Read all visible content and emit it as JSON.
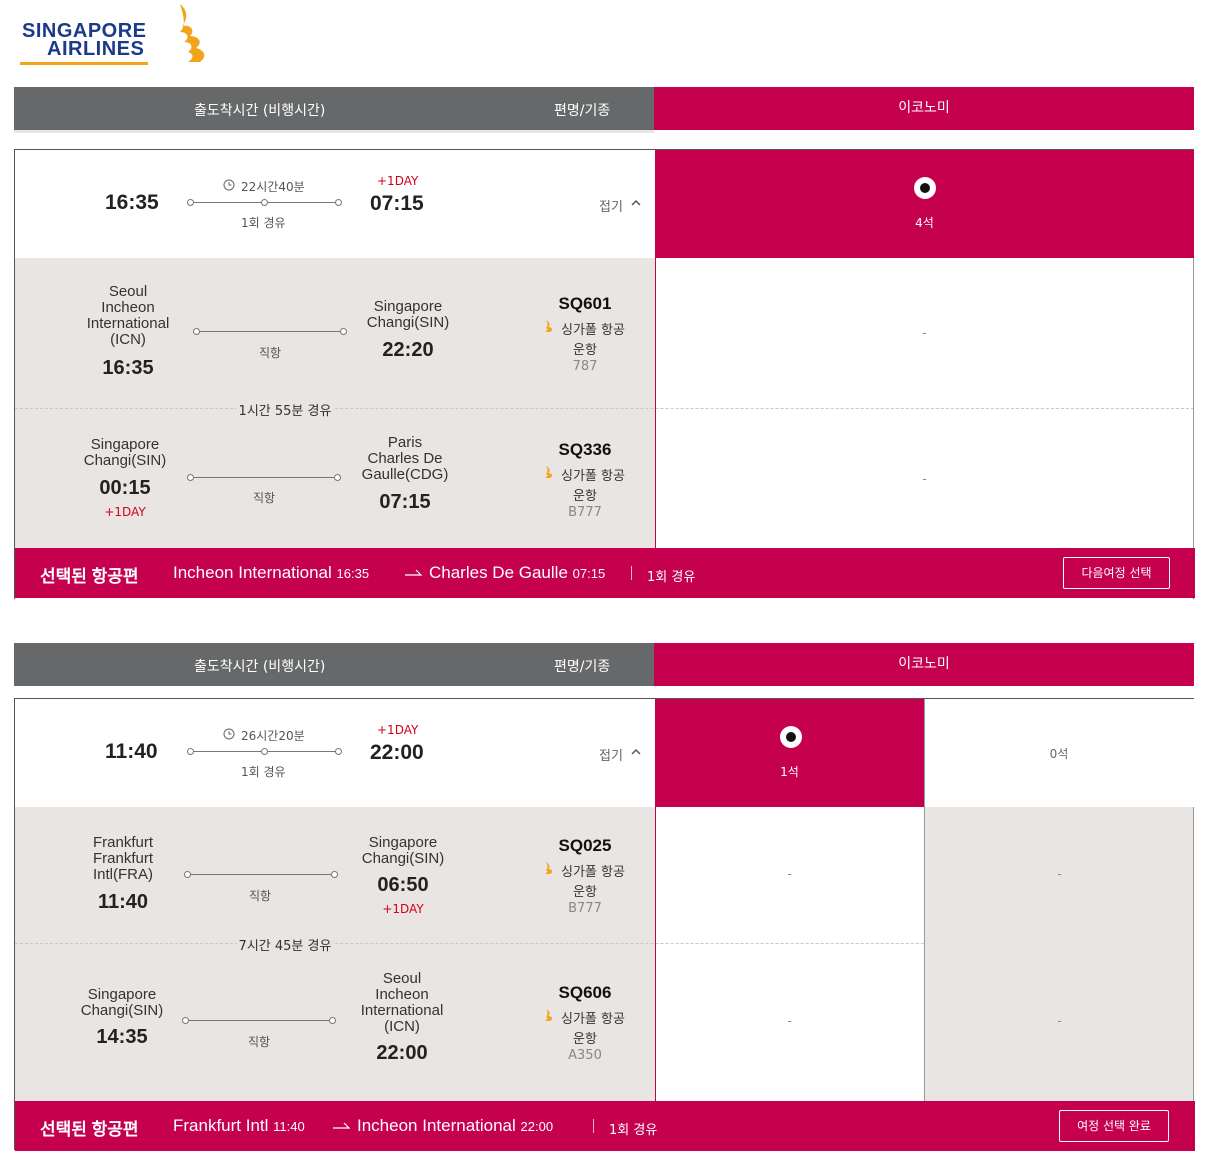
{
  "brand": {
    "line1": "SINGAPORE",
    "line2": "AIRLINES",
    "colors": {
      "navy": "#1b3a8a",
      "gold": "#f2a51b"
    }
  },
  "colors": {
    "accent": "#c4004f",
    "header_gray": "#676869",
    "segment_bg": "#e8e5e2",
    "red": "#d0021b"
  },
  "header": {
    "col_time": "출도착시간 (비행시간)",
    "col_flight": "편명/기종",
    "col_cabin": "이코노미"
  },
  "outbound": {
    "summary": {
      "dep": "16:35",
      "arr": "07:15",
      "duration": "22시간40분",
      "plus_day": "+1DAY",
      "stops": "1회 경유",
      "fold": "접기",
      "seats": "4석"
    },
    "segments": [
      {
        "from_city": [
          "Seoul",
          "Incheon",
          "International",
          "(ICN)"
        ],
        "dep": "16:35",
        "to_city": [
          "Singapore",
          "Changi(SIN)"
        ],
        "arr": "22:20",
        "type": "직항",
        "flight": "SQ601",
        "airline": "싱가폴 항공",
        "op": "운항",
        "aircraft": "787",
        "eco": "-"
      },
      {
        "from_city": [
          "Singapore",
          "Changi(SIN)"
        ],
        "dep": "00:15",
        "dep_plus": "+1DAY",
        "to_city": [
          "Paris",
          "Charles De",
          "Gaulle(CDG)"
        ],
        "arr": "07:15",
        "type": "직항",
        "flight": "SQ336",
        "airline": "싱가폴 항공",
        "op": "운항",
        "aircraft": "B777",
        "eco": "-"
      }
    ],
    "layover": "1시간 55분 경유",
    "selected": {
      "label": "선택된 항공편",
      "from": "Incheon International",
      "dep": "16:35",
      "to": "Charles De Gaulle",
      "arr": "07:15",
      "stops": "1회 경유",
      "button": "다음여정 선택"
    }
  },
  "inbound": {
    "summary": {
      "dep": "11:40",
      "arr": "22:00",
      "duration": "26시간20분",
      "plus_day": "+1DAY",
      "stops": "1회 경유",
      "fold": "접기",
      "seats": "1석",
      "seats2": "0석"
    },
    "segments": [
      {
        "from_city": [
          "Frankfurt",
          "Frankfurt",
          "Intl(FRA)"
        ],
        "dep": "11:40",
        "to_city": [
          "Singapore",
          "Changi(SIN)"
        ],
        "arr": "06:50",
        "arr_plus": "+1DAY",
        "type": "직항",
        "flight": "SQ025",
        "airline": "싱가폴 항공",
        "op": "운항",
        "aircraft": "B777",
        "eco": "-",
        "eco2": "-"
      },
      {
        "from_city": [
          "Singapore",
          "Changi(SIN)"
        ],
        "dep": "14:35",
        "to_city": [
          "Seoul",
          "Incheon",
          "International",
          "(ICN)"
        ],
        "arr": "22:00",
        "type": "직항",
        "flight": "SQ606",
        "airline": "싱가폴 항공",
        "op": "운항",
        "aircraft": "A350",
        "eco": "-",
        "eco2": "-"
      }
    ],
    "layover": "7시간 45분 경유",
    "selected": {
      "label": "선택된 항공편",
      "from": "Frankfurt Intl",
      "dep": "11:40",
      "to": "Incheon International",
      "arr": "22:00",
      "stops": "1회 경유",
      "button": "여정 선택 완료"
    }
  },
  "icons": [
    "clock-icon",
    "chevron-up-icon",
    "singapore-bird-icon",
    "arrow-right-icon",
    "radio-selected-icon"
  ]
}
